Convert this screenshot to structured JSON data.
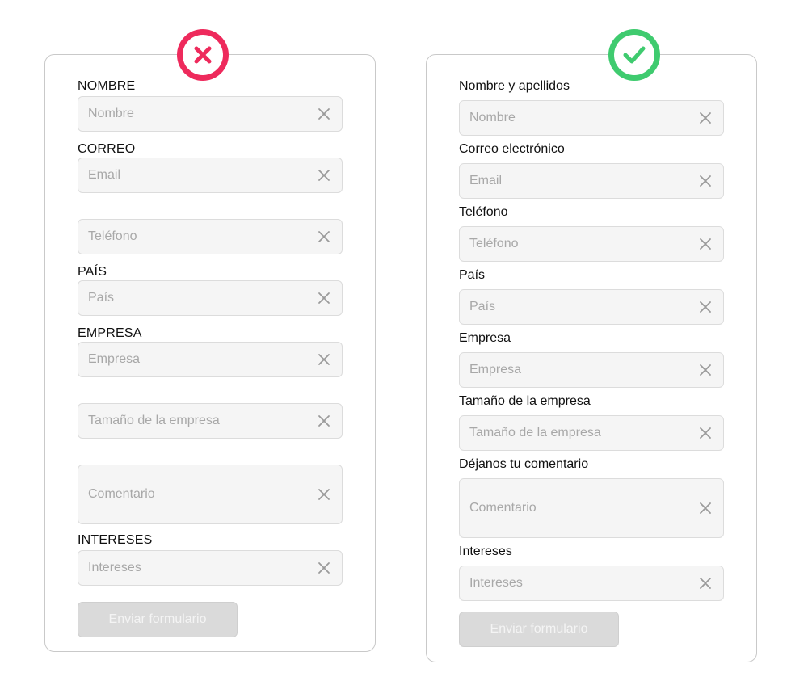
{
  "bad_form": {
    "status_icon": "x-circle-icon",
    "status_color": "#ee2a5c",
    "labels": {
      "nombre": "NOMBRE",
      "correo": "CORREO",
      "pais": "PAÍS",
      "empresa": "EMPRESA",
      "intereses": "INTERESES"
    },
    "placeholders": {
      "nombre": "Nombre",
      "email": "Email",
      "telefono": "Teléfono",
      "pais": "País",
      "empresa": "Empresa",
      "tamano": "Tamaño de la empresa",
      "comentario": "Comentario",
      "intereses": "Intereses"
    },
    "submit_label": "Enviar formulario"
  },
  "good_form": {
    "status_icon": "check-circle-icon",
    "status_color": "#3fcb6f",
    "labels": {
      "nombre": "Nombre y apellidos",
      "correo": "Correo electrónico",
      "telefono": "Teléfono",
      "pais": "País",
      "empresa": "Empresa",
      "tamano": "Tamaño de la empresa",
      "comentario": "Déjanos tu comentario",
      "intereses": "Intereses"
    },
    "placeholders": {
      "nombre": "Nombre",
      "email": "Email",
      "telefono": "Teléfono",
      "pais": "País",
      "empresa": "Empresa",
      "tamano": "Tamaño de la empresa",
      "comentario": "Comentario",
      "intereses": "Intereses"
    },
    "submit_label": "Enviar formulario"
  },
  "field_clear_icon": "close-icon"
}
